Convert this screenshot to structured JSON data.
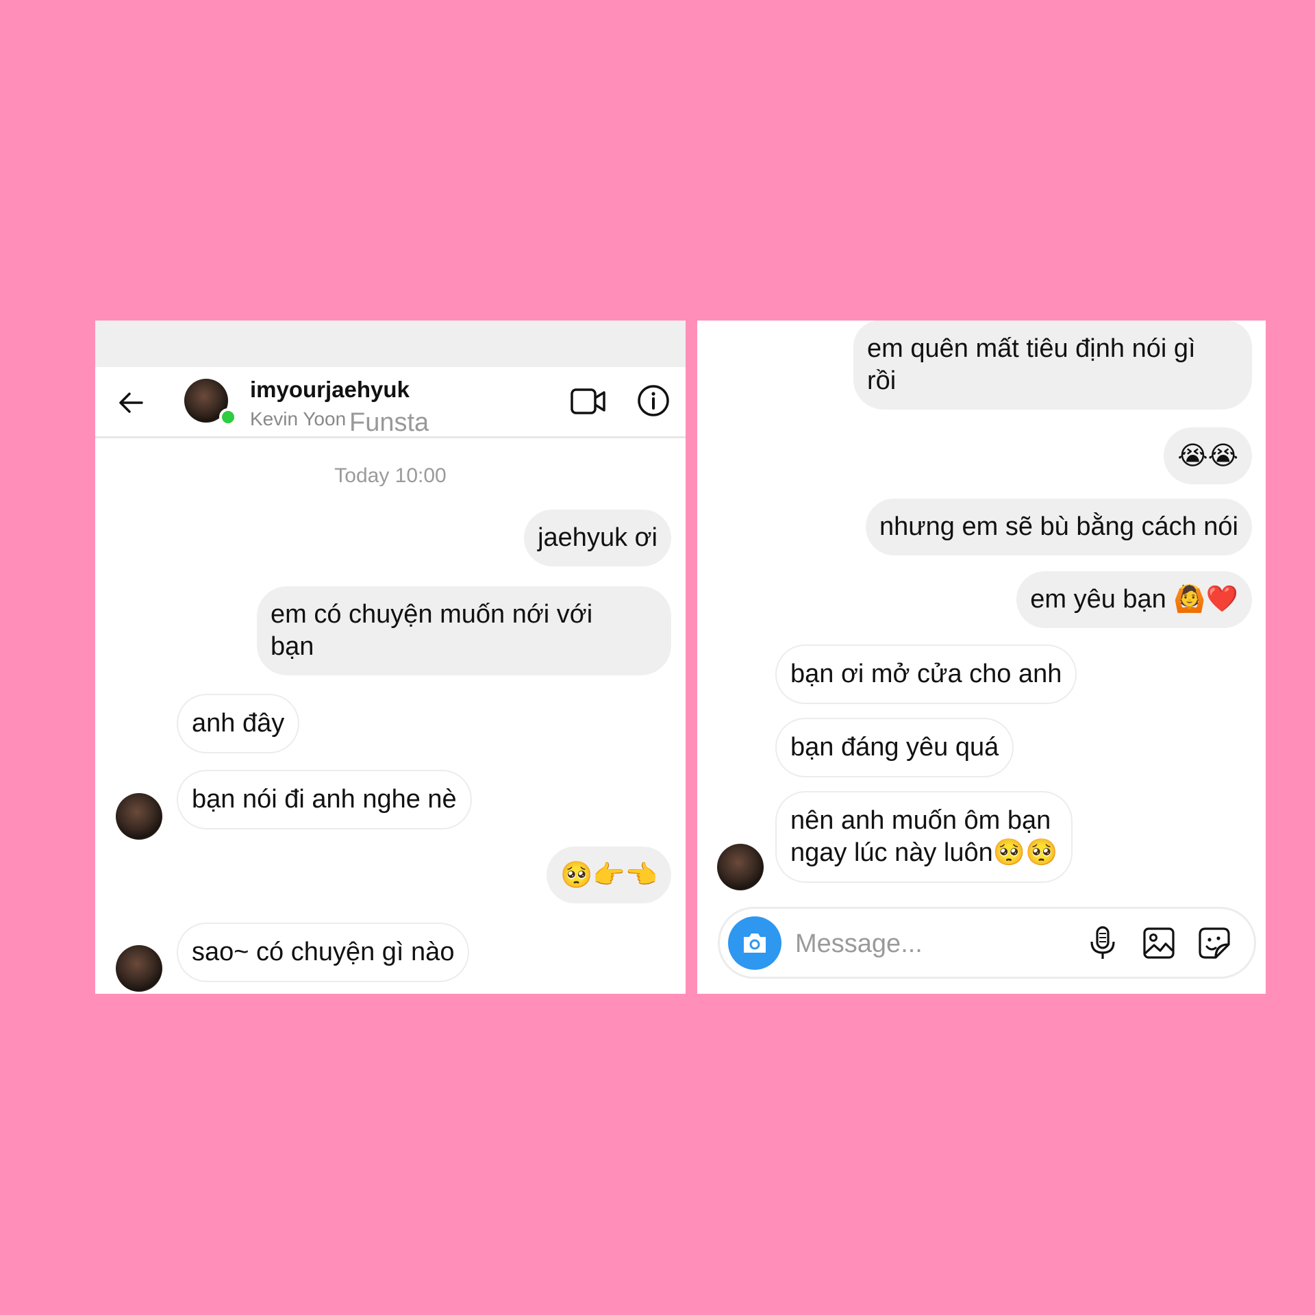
{
  "header": {
    "username": "imyourjaehyuk",
    "real_name": "Kevin Yoon",
    "overlay_text": "Funsta"
  },
  "left_chat": {
    "timestamp": "Today 10:00",
    "messages": [
      {
        "from": "me",
        "text": "jaehyuk ơi"
      },
      {
        "from": "me",
        "text": "em có chuyện muốn nới với",
        "text2": "bạn"
      },
      {
        "from": "them",
        "text": "anh đây"
      },
      {
        "from": "them",
        "text": "bạn nói đi anh nghe nè"
      },
      {
        "from": "me",
        "text": "🥺👉👈"
      },
      {
        "from": "them",
        "text": "sao~ có chuyện gì nào"
      }
    ]
  },
  "right_chat": {
    "messages": [
      {
        "from": "me",
        "text": "em quên mất tiêu định nói gì",
        "text2": "rồi"
      },
      {
        "from": "me",
        "text": "😭😭"
      },
      {
        "from": "me",
        "text": "nhưng em sẽ bù bằng cách nói"
      },
      {
        "from": "me",
        "text": "em yêu bạn 🙆❤️"
      },
      {
        "from": "them",
        "text": "bạn ơi mở cửa cho anh"
      },
      {
        "from": "them",
        "text": "bạn đáng yêu quá"
      },
      {
        "from": "them",
        "text": "nên anh muốn ôm bạn",
        "text2": "ngay lúc này luôn🥺🥺"
      }
    ]
  },
  "composer": {
    "placeholder": "Message..."
  },
  "colors": {
    "background": "#ff8fb8",
    "outgoing_bubble": "#efefef",
    "incoming_bubble": "#ffffff",
    "camera_button": "#2e97f0",
    "online_indicator": "#2ecc40"
  },
  "icons": [
    "back-arrow-icon",
    "video-call-icon",
    "info-icon",
    "camera-icon",
    "microphone-icon",
    "gallery-icon",
    "sticker-icon"
  ]
}
